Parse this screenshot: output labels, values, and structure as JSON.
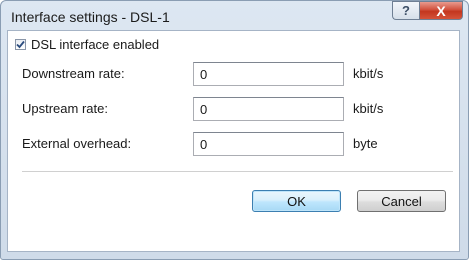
{
  "window": {
    "title": "Interface settings - DSL-1",
    "help_glyph": "?",
    "close_glyph": "X",
    "close_color": "#c3361f"
  },
  "form": {
    "dsl_enabled": {
      "label": "DSL interface enabled",
      "checked": true
    },
    "downstream": {
      "label": "Downstream rate:",
      "value": "0",
      "unit": "kbit/s"
    },
    "upstream": {
      "label": "Upstream rate:",
      "value": "0",
      "unit": "kbit/s"
    },
    "overhead": {
      "label": "External overhead:",
      "value": "0",
      "unit": "byte"
    }
  },
  "buttons": {
    "ok_label": "OK",
    "cancel_label": "Cancel"
  }
}
